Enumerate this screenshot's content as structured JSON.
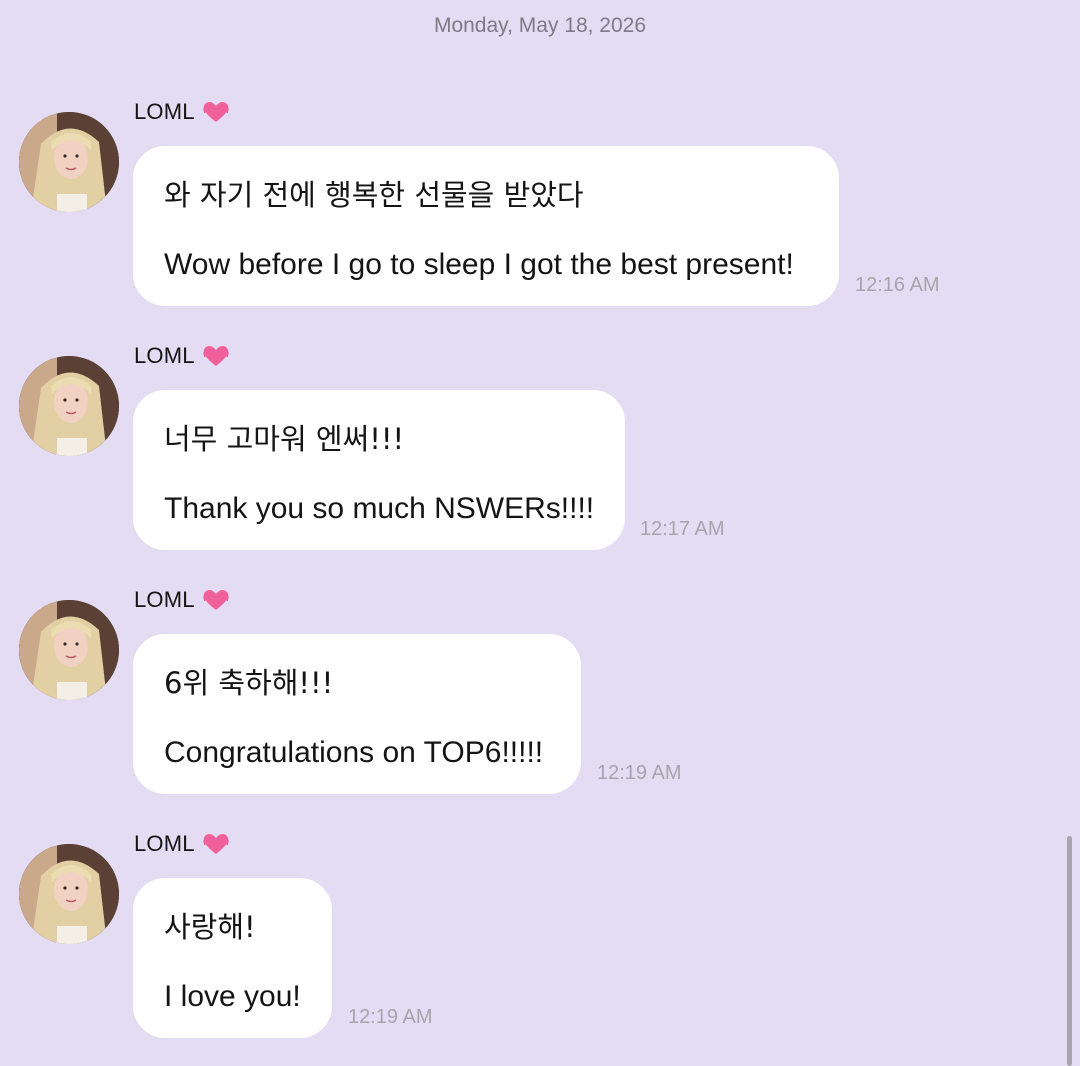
{
  "conversation": {
    "date_header": "Monday, May 18, 2026",
    "messages": [
      {
        "sender": "LOML",
        "sender_emoji": "💓",
        "text_korean": "와 자기 전에 행복한 선물을 받았다",
        "text_english": "Wow before I go to sleep I got the best present!",
        "time": "12:16 AM"
      },
      {
        "sender": "LOML",
        "sender_emoji": "💓",
        "text_korean": "너무 고마워 엔써!!!",
        "text_english": "Thank you so much NSWERs!!!!",
        "time": "12:17 AM"
      },
      {
        "sender": "LOML",
        "sender_emoji": "💓",
        "text_korean": "6위 축하해!!!",
        "text_english": "Congratulations on TOP6!!!!!",
        "time": "12:19 AM"
      },
      {
        "sender": "LOML",
        "sender_emoji": "💓",
        "text_korean": "사랑해!",
        "text_english": "I love you!",
        "time": "12:19 AM"
      }
    ]
  },
  "colors": {
    "background": "#e4dcf2",
    "bubble": "#ffffff",
    "timestamp": "#a8a3ad",
    "heart": "#f0609a"
  }
}
